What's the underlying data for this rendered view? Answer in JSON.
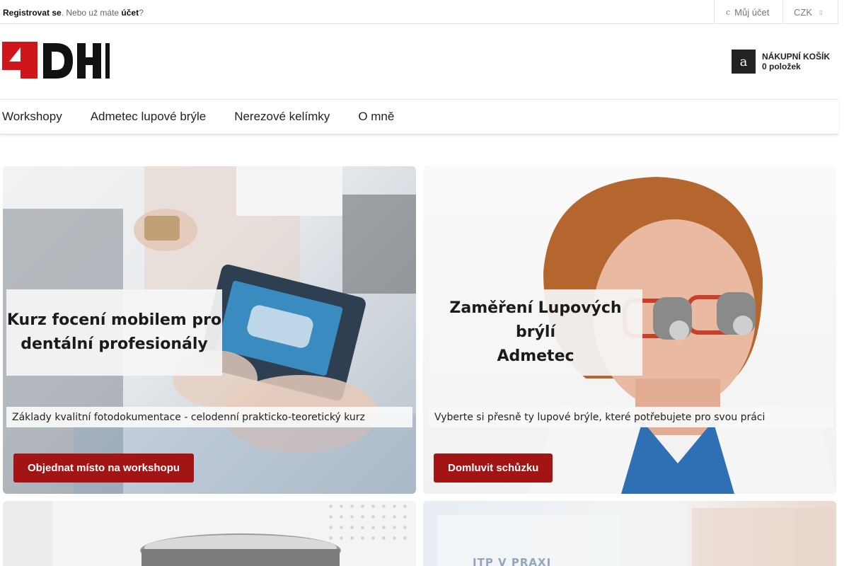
{
  "topbar": {
    "register_link": "Registrovat se",
    "middle_text": ". Nebo už máte ",
    "account_link": "účet",
    "question_mark": "?",
    "account_icon_glyph": "c",
    "account_label": "Můj účet",
    "currency": "CZK",
    "currency_caret": "▯"
  },
  "header": {
    "logo_text": "4DH",
    "logo_icon": "4dh-logo",
    "cart_icon_glyph": "a",
    "cart_title": "NÁKUPNÍ KOŠÍK",
    "cart_count": "0 položek"
  },
  "nav": {
    "items": [
      {
        "label": "Workshopy"
      },
      {
        "label": "Admetec lupové brýle"
      },
      {
        "label": "Nerezové kelímky"
      },
      {
        "label": "O mně"
      }
    ]
  },
  "banners": [
    {
      "title_line1": "Kurz focení mobilem pro",
      "title_line2": "dentální profesionály",
      "subtitle": "Základy kvalitní fotodokumentace - celodenní prakticko-teoretický kurz",
      "cta": "Objednat místo na workshopu"
    },
    {
      "title_line1": "Zaměření Lupových brýlí",
      "title_line2": "Admetec",
      "subtitle": "Vyberte si přesně ty lupové brýle, které potřebujete pro svou práci",
      "cta": "Domluvit schůzku"
    },
    {
      "partial_text": ""
    },
    {
      "partial_text": "ITP V PRAXI"
    }
  ],
  "colors": {
    "brand_red": "#a31515",
    "logo_red": "#d0161b",
    "text_dark": "#222222"
  }
}
